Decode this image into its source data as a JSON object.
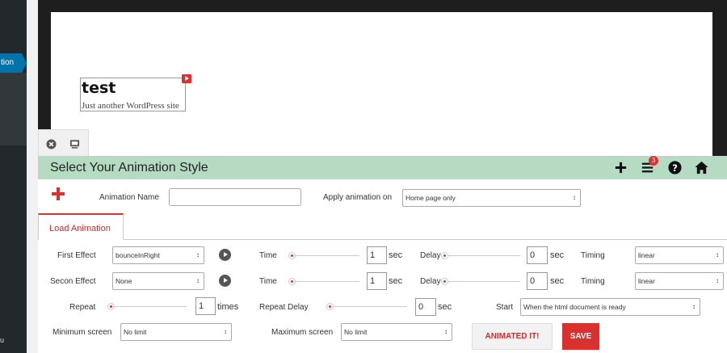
{
  "sidebar": {
    "active_item": "tion",
    "bottom_text": "u"
  },
  "preview": {
    "site_title": "test",
    "site_tagline": "Just another WordPress site"
  },
  "header": {
    "title": "Select Your Animation Style",
    "notification_count": "3"
  },
  "form": {
    "animation_name_label": "Animation Name",
    "animation_name_value": "",
    "apply_label": "Apply animation on",
    "apply_value": "Home page only",
    "tab_label": "Load Animation",
    "first_effect_label": "First Effect",
    "first_effect_value": "bounceInRight",
    "second_effect_label": "Secon Effect",
    "second_effect_value": "None",
    "time_label": "Time",
    "delay_label": "Delay",
    "sec_unit": "sec",
    "timing_label": "Timing",
    "timing_value": "linear",
    "first_time": "1",
    "first_delay": "0",
    "second_time": "1",
    "second_delay": "0",
    "repeat_label": "Repeat",
    "repeat_value": "1",
    "times_unit": "times",
    "repeat_delay_label": "Repeat Delay",
    "repeat_delay_value": "0",
    "start_label": "Start",
    "start_value": "When the html document is ready",
    "min_screen_label": "Minimum screen",
    "min_screen_value": "No limit",
    "max_screen_label": "Maximum screen",
    "max_screen_value": "No limit",
    "animate_button": "ANIMATED IT!",
    "save_button": "SAVE"
  },
  "colors": {
    "accent_red": "#d9312f",
    "header_green": "#b5dbc3",
    "wp_blue": "#0073aa"
  },
  "icons": [
    "close-circle-icon",
    "monitor-icon",
    "plus-icon",
    "menu-icon",
    "help-icon",
    "home-icon",
    "play-icon",
    "caret-updown-icon"
  ]
}
